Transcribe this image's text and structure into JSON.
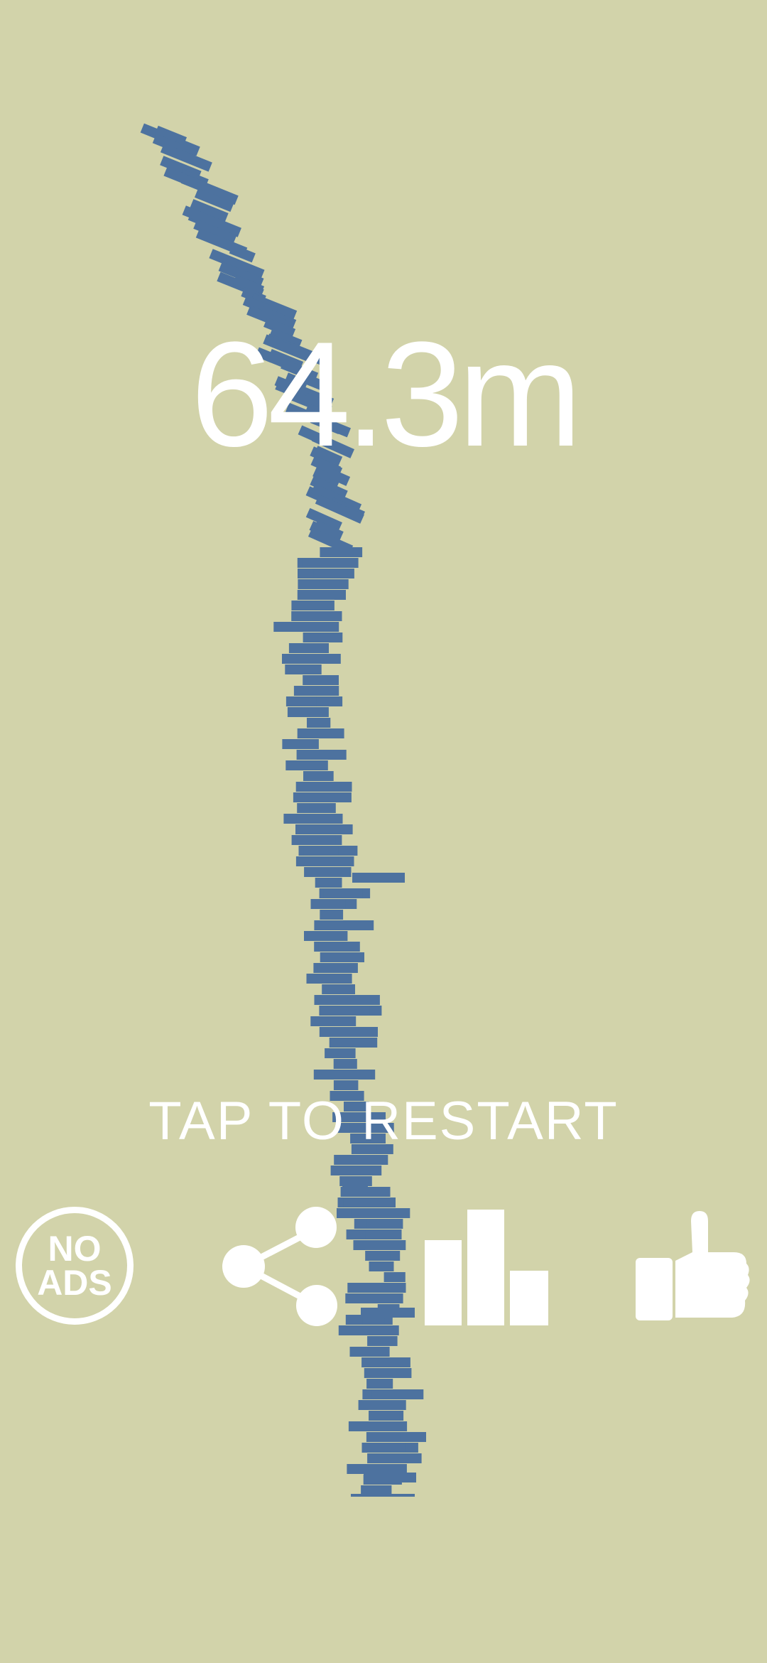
{
  "game": {
    "score": "64.3m",
    "restart_label": "TAP TO RESTART",
    "no_ads_line1": "NO",
    "no_ads_line2": "ADS"
  },
  "icons": {
    "share": "share-icon",
    "leaderboard": "leaderboard-icon",
    "like": "thumbs-up-icon"
  },
  "colors": {
    "background": "#d2d3aa",
    "blocks": "#4d729f",
    "text": "#ffffff"
  }
}
